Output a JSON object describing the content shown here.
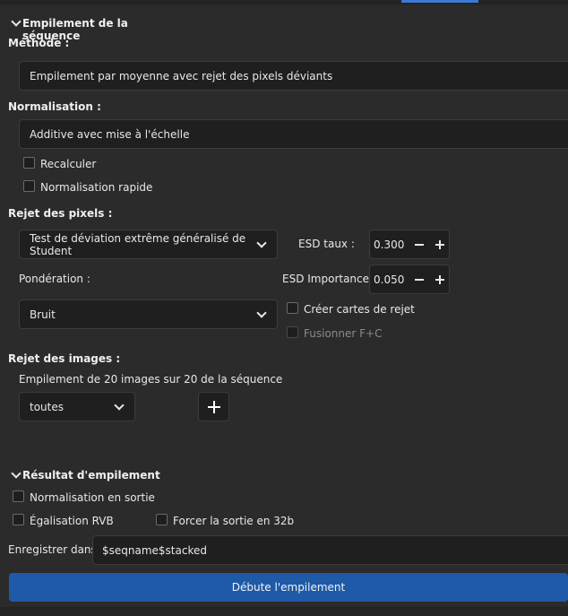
{
  "sequence_stacking": {
    "header": "Empilement de la séquence",
    "method_label": "Méthode :",
    "method_value": "Empilement par moyenne avec rejet des pixels déviants",
    "normalization_label": "Normalisation :",
    "normalization_value": "Additive avec mise à l'échelle",
    "recompute_label": "Recalculer",
    "fast_normalization_label": "Normalisation rapide",
    "pixel_rejection_label": "Rejet des pixels :",
    "rejection_algorithm_value": "Test de déviation extrême généralisé de Student",
    "esd_rate_label": "ESD taux :",
    "esd_rate_value": "0.300",
    "weighting_label": "Pondération :",
    "esd_importance_label": "ESD Importance :",
    "esd_importance_value": "0.050",
    "weighting_value": "Bruit",
    "create_rejection_maps_label": "Créer cartes de rejet",
    "merge_label": "Fusionner F+C",
    "image_rejection_label": "Rejet des images :",
    "image_rejection_summary": "Empilement de 20 images sur 20 de la séquence",
    "image_filter_value": "toutes"
  },
  "stacking_result": {
    "header": "Résultat d'empilement",
    "output_normalization_label": "Normalisation en sortie",
    "rgb_equalization_label": "Égalisation RVB",
    "force_32b_label": "Forcer la sortie en 32b",
    "save_in_label": "Enregistrer dans :",
    "save_in_value": "$seqname$stacked"
  },
  "actions": {
    "start_button_label": "Débute l'empilement"
  },
  "colors": {
    "background": "#2b2b2b",
    "field": "#1f1f1f",
    "accent_blue": "#1e5aa8"
  }
}
